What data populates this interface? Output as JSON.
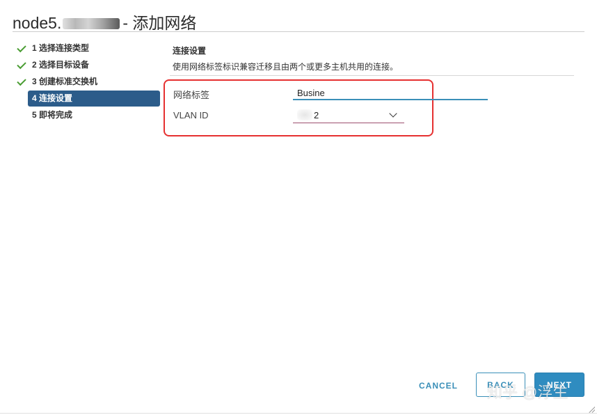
{
  "dialog": {
    "title_prefix": "node5.",
    "title_suffix": "- 添加网络"
  },
  "steps": [
    {
      "label": "1 选择连接类型",
      "completed": true
    },
    {
      "label": "2 选择目标设备",
      "completed": true
    },
    {
      "label": "3 创建标准交换机",
      "completed": true
    },
    {
      "label": "4 连接设置",
      "active": true
    },
    {
      "label": "5 即将完成",
      "completed": false
    }
  ],
  "section": {
    "title": "连接设置",
    "description": "使用网络标签标识兼容迁移且由两个或更多主机共用的连接。"
  },
  "fields": {
    "network_label": {
      "label": "网络标签",
      "value": "Busine"
    },
    "vlan_id": {
      "label": "VLAN ID",
      "value": "2"
    }
  },
  "buttons": {
    "cancel": "CANCEL",
    "back": "BACK",
    "next": "NEXT"
  },
  "watermark": "知乎 @浮生",
  "colors": {
    "accent": "#3a8fb8",
    "active_step_bg": "#2c5c8a",
    "check": "#4a9d33",
    "highlight_box": "#e63030"
  }
}
